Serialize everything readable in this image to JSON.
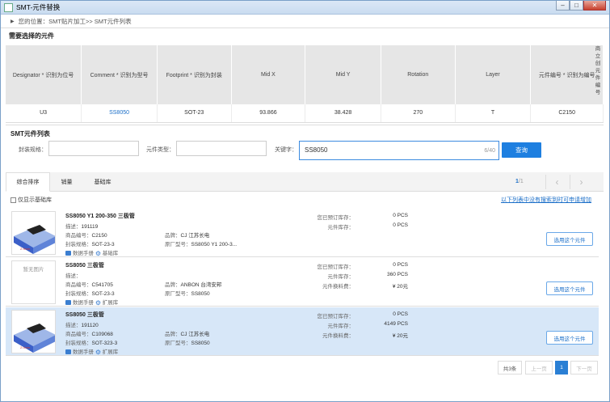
{
  "window": {
    "title": "SMT-元件替换"
  },
  "breadcrumb": "您的位置：SMT贴片加工>> SMT元件列表",
  "needed_section_title": "需要选择的元件",
  "table": {
    "headers": [
      "Designator * 识别为位号",
      "Comment * 识别为型号",
      "Footprint * 识别为封装",
      "Mid X",
      "Mid Y",
      "Rotation",
      "Layer",
      "元件编号 * 识别为编号"
    ],
    "row": [
      "U3",
      "SS8050",
      "SOT-23",
      "93.866",
      "38.428",
      "270",
      "T",
      "C2150"
    ],
    "overflow_header": "商立创元件编号"
  },
  "list_panel": {
    "title": "SMT元件列表",
    "package_label": "封装规格：",
    "type_label": "元件类型：",
    "keyword_label": "关键字：",
    "keyword_value": "SS8050",
    "keyword_count": "6/40",
    "query_button": "查询"
  },
  "tabs": [
    "综合排序",
    "销量",
    "基础库"
  ],
  "page_indicator": {
    "current": "1",
    "total": "/1"
  },
  "nav": {
    "prev": "‹",
    "next": "›"
  },
  "only_basic_label": "仅显示基础库",
  "hint_link": "以下列表中没有搜索到时可申请增加",
  "labels": {
    "desc": "描述：",
    "product_code": "商品编号：",
    "package": "封装规格：",
    "brand": "品牌：",
    "mfr_part": "原厂型号：",
    "datasheet": "数据手册",
    "ordered_stock": "您已预订库存：",
    "stock": "元件库存：",
    "loading_fee": "元件换料费：",
    "use_button": "选用这个元件",
    "no_image": "暂无图片"
  },
  "items": [
    {
      "name": "SS8050 Y1 200-350 三极管",
      "desc": "191119",
      "code": "C2150",
      "package": "SOT-23-3",
      "brand": "CJ 江苏长电",
      "mfr": "SS8050 Y1 200-3...",
      "lib": "基础库",
      "ordered": "0 PCS",
      "stock": "0 PCS",
      "fee": ""
    },
    {
      "name": "SS8050 三极管",
      "desc": "",
      "code": "C541705",
      "package": "SOT-23-3",
      "brand": "ANBON 台湾安邦",
      "mfr": "SS8050",
      "lib": "扩展库",
      "ordered": "0 PCS",
      "stock": "360 PCS",
      "fee": "¥ 20元"
    },
    {
      "name": "SS8050 三极管",
      "desc": "191120",
      "code": "C109068",
      "package": "SOT-323-3",
      "brand": "CJ 江苏长电",
      "mfr": "SS8050",
      "lib": "扩展库",
      "ordered": "0 PCS",
      "stock": "4149 PCS",
      "fee": "¥ 20元"
    }
  ],
  "pagination": {
    "total": "共3条",
    "prev": "上一页",
    "page": "1",
    "next": "下一页"
  }
}
